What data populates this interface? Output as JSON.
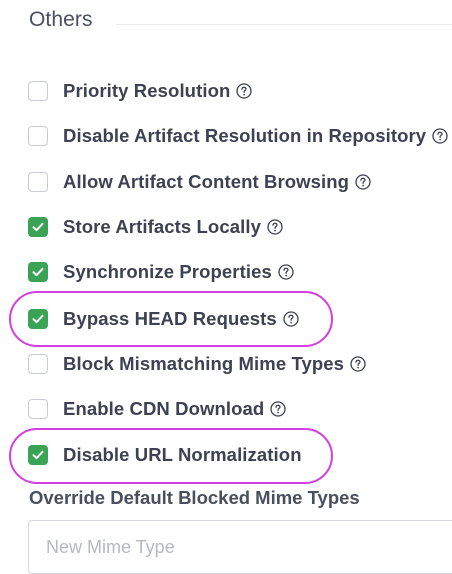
{
  "section": {
    "title": "Others"
  },
  "options": [
    {
      "label": "Priority Resolution",
      "checked": false,
      "has_help": true
    },
    {
      "label": "Disable Artifact Resolution in Repository",
      "checked": false,
      "has_help": true
    },
    {
      "label": "Allow Artifact Content Browsing",
      "checked": false,
      "has_help": true
    },
    {
      "label": "Store Artifacts Locally",
      "checked": true,
      "has_help": true
    },
    {
      "label": "Synchronize Properties",
      "checked": true,
      "has_help": true
    },
    {
      "label": "Bypass HEAD Requests",
      "checked": true,
      "has_help": true,
      "highlighted": true
    },
    {
      "label": "Block Mismatching Mime Types",
      "checked": false,
      "has_help": true
    },
    {
      "label": "Enable CDN Download",
      "checked": false,
      "has_help": true
    },
    {
      "label": "Disable URL Normalization",
      "checked": true,
      "has_help": false,
      "highlighted": true
    }
  ],
  "mime_types": {
    "label": "Override Default Blocked Mime Types",
    "placeholder": "New Mime Type",
    "value": ""
  },
  "icons": {
    "check": "check-icon",
    "help": "help-circle-icon"
  },
  "colors": {
    "checkbox_checked": "#3aa356",
    "checkbox_border": "#c8cbd3",
    "annotation_highlight": "#d33fe0",
    "text": "#3d4151"
  }
}
